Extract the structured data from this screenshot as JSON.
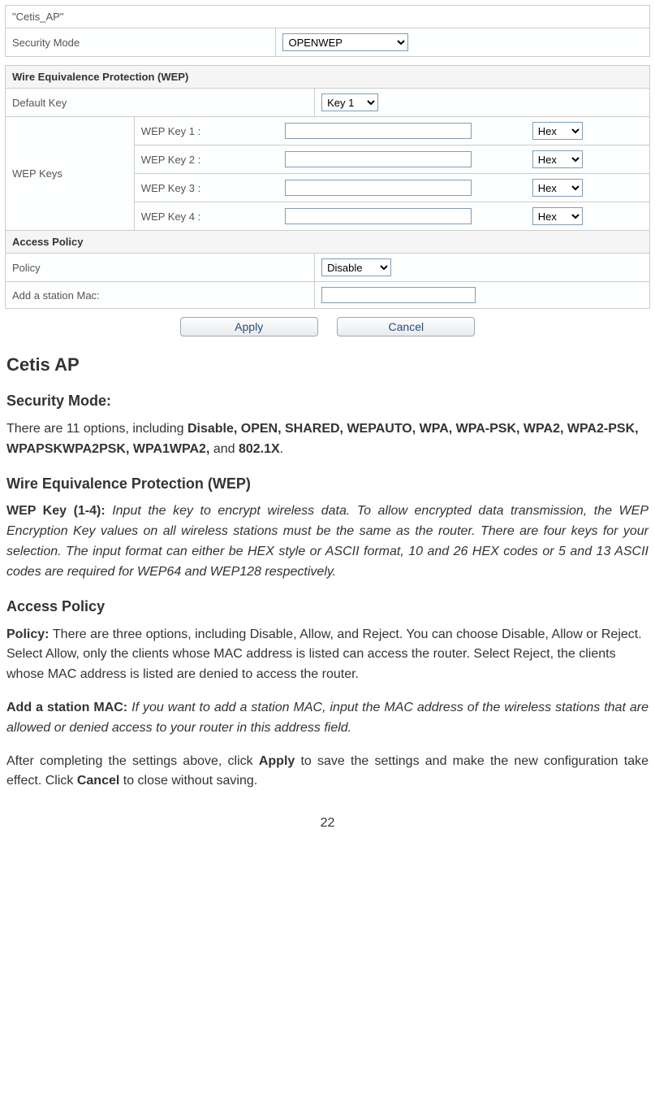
{
  "form": {
    "ap_name": "\"Cetis_AP\"",
    "security_mode_label": "Security Mode",
    "security_mode_value": "OPENWEP",
    "wep_header": "Wire Equivalence Protection (WEP)",
    "default_key_label": "Default Key",
    "default_key_value": "Key 1",
    "wep_keys_label": "WEP Keys",
    "wep_keys": [
      {
        "label": "WEP Key 1 :",
        "value": "",
        "fmt": "Hex"
      },
      {
        "label": "WEP Key 2 :",
        "value": "",
        "fmt": "Hex"
      },
      {
        "label": "WEP Key 3 :",
        "value": "",
        "fmt": "Hex"
      },
      {
        "label": "WEP Key 4 :",
        "value": "",
        "fmt": "Hex"
      }
    ],
    "access_policy_header": "Access Policy",
    "policy_label": "Policy",
    "policy_value": "Disable",
    "add_station_label": "Add a station Mac:",
    "add_station_value": "",
    "apply_label": "Apply",
    "cancel_label": "Cancel"
  },
  "doc": {
    "title": "Cetis AP",
    "sec_mode_heading": "Security Mode:",
    "sec_mode_intro": "There are 11 options, including ",
    "sec_mode_bold": "Disable, OPEN, SHARED, WEPAUTO, WPA, WPA-PSK, WPA2, WPA2-PSK, WPAPSKWPA2PSK, WPA1WPA2,",
    "sec_mode_tail1": " and ",
    "sec_mode_tail2": "802.1X",
    "sec_mode_period": ".",
    "wep_heading": "Wire Equivalence Protection (WEP)",
    "wep_key_label": "WEP Key (1-4): ",
    "wep_key_body": "Input the key to encrypt wireless data. To allow encrypted data transmission, the WEP Encryption Key values on all wireless stations must be the same as the router. There are four keys for your selection. The input format can either be HEX style or ASCII format, 10 and 26 HEX codes or 5 and 13 ASCII codes are required for WEP64 and WEP128 respectively.",
    "access_policy_heading": "Access Policy",
    "policy_label": "Policy: ",
    "policy_body": "There are three options, including Disable, Allow, and Reject. You can choose Disable, Allow or Reject. Select Allow, only the clients whose MAC address is listed can access the router. Select Reject, the clients whose MAC address is listed are denied to access the router.",
    "add_mac_label": "Add a station MAC: ",
    "add_mac_body": "If you want to add a station MAC, input the MAC address of the wireless stations that are allowed or denied access to your router in this address field.",
    "after_intro": "After completing the settings above, click ",
    "after_apply": "Apply",
    "after_mid": " to save the settings and make the new configuration take effect. Click ",
    "after_cancel": "Cancel",
    "after_tail": " to close without saving.",
    "page_number": "22"
  }
}
